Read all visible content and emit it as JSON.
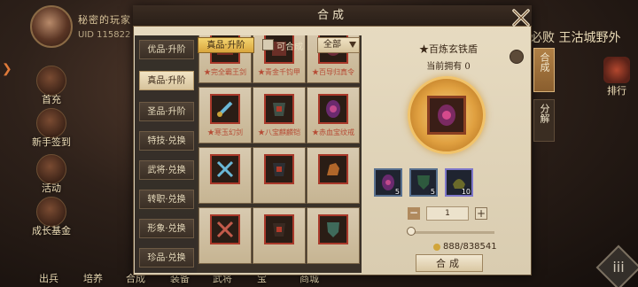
{
  "hud": {
    "player_name": "秘密的玩家",
    "uid": "UID 115822",
    "top_right_text": "必败 王沽城野外",
    "rank_label": "排行",
    "side_buttons": [
      "首充",
      "新手签到",
      "活动",
      "成长基金"
    ],
    "bottom_items": [
      "出兵",
      "培养",
      "合成",
      "装备",
      "武将",
      "宝",
      "商城"
    ],
    "menu_glyph": "iii"
  },
  "dialog": {
    "title": "合成",
    "categories": [
      "优品·升阶",
      "真品·升阶",
      "圣品·升阶",
      "特技·兑换",
      "武将·兑换",
      "转职·兑换",
      "形象·兑换",
      "珍品·兑换"
    ],
    "active_category_index": 1,
    "filter_tab": "真品·升阶",
    "only_craftable_label": "可合成",
    "dropdown_value": "全部",
    "items": [
      {
        "label": "★完全霸王剑",
        "icon": "weapon-icon"
      },
      {
        "label": "★青金千钧甲",
        "icon": "armor-icon"
      },
      {
        "label": "★百导归真令",
        "icon": "medal-icon"
      },
      {
        "label": "★寒玉幻剑",
        "icon": "sword-icon"
      },
      {
        "label": "★八宝麒麟铠",
        "icon": "armor-icon"
      },
      {
        "label": "★赤血宝纹戒",
        "icon": "ring-icon"
      },
      {
        "label": "",
        "icon": "crossed-swords-icon"
      },
      {
        "label": "",
        "icon": "armor-icon"
      },
      {
        "label": "",
        "icon": "mount-icon"
      },
      {
        "label": "",
        "icon": "crossed-swords-icon"
      },
      {
        "label": "",
        "icon": "armor-icon"
      },
      {
        "label": "",
        "icon": "shield-icon"
      }
    ],
    "detail": {
      "item_name": "★百炼玄铁盾",
      "owned_label": "当前拥有",
      "owned_count": "0",
      "materials": [
        {
          "count": "5",
          "border": "#58708e"
        },
        {
          "count": "5",
          "border": "#58708e"
        },
        {
          "count": "10",
          "border": "#7e77c9"
        }
      ],
      "quantity": "1",
      "cost": "888/838541",
      "craft_label": "合成"
    },
    "side_tabs": [
      "合成",
      "分解"
    ]
  }
}
